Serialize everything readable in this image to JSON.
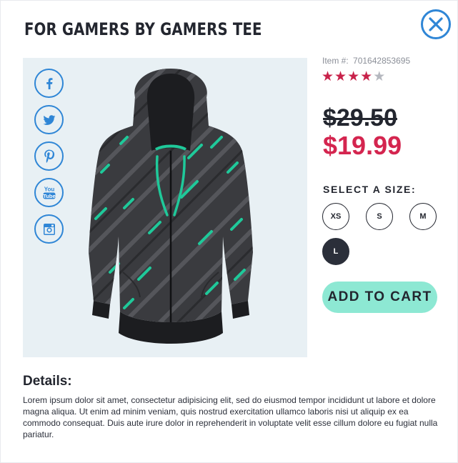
{
  "product": {
    "title": "FOR GAMERS BY GAMERS TEE",
    "item_label": "Item #:",
    "item_number": "701642853695",
    "rating": 4,
    "rating_max": 5,
    "old_price": "$29.50",
    "new_price": "$19.99"
  },
  "sizes": {
    "label": "SELECT A SIZE:",
    "options": [
      "XS",
      "S",
      "M",
      "L"
    ],
    "selected": "L"
  },
  "cart": {
    "label": "ADD TO CART"
  },
  "details": {
    "heading": "Details:",
    "text": "Lorem ipsum dolor sit amet, consectetur adipisicing elit, sed do eiusmod tempor incididunt ut labore et dolore magna aliqua. Ut enim ad minim veniam, quis nostrud exercitation ullamco laboris nisi ut aliquip ex ea commodo consequat. Duis aute irure dolor in reprehenderit in voluptate velit esse cillum dolore eu fugiat nulla pariatur."
  },
  "share": {
    "icons": [
      "facebook-icon",
      "twitter-icon",
      "pinterest-icon",
      "youtube-icon",
      "instagram-icon"
    ],
    "youtube_line1": "You",
    "youtube_line2": "Tube"
  },
  "colors": {
    "accent_blue": "#2f86d6",
    "price_red": "#d4254f",
    "cart_mint": "#8de8d3",
    "star_filled": "#c8224a",
    "star_empty": "#b5b8bf",
    "dark": "#23262f",
    "hoodie_accent": "#1fc99a"
  }
}
